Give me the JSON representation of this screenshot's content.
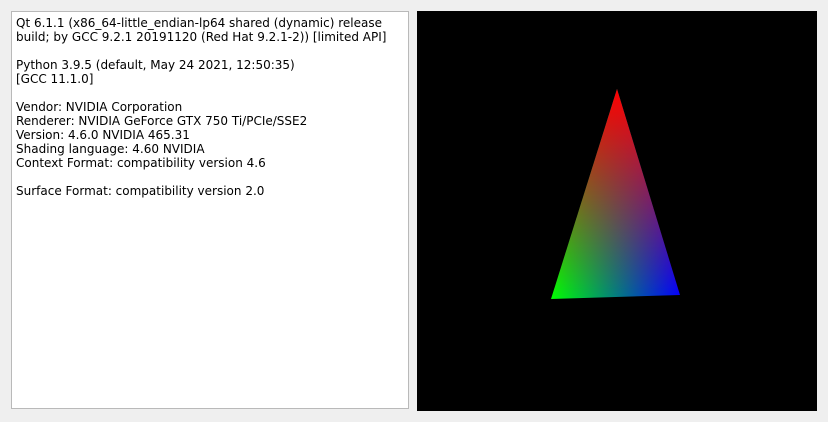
{
  "info_panel": {
    "text": "Qt 6.1.1 (x86_64-little_endian-lp64 shared (dynamic) release\nbuild; by GCC 9.2.1 20191120 (Red Hat 9.2.1-2)) [limited API]\n\nPython 3.9.5 (default, May 24 2021, 12:50:35)\n[GCC 11.1.0]\n\nVendor: NVIDIA Corporation\nRenderer: NVIDIA GeForce GTX 750 Ti/PCIe/SSE2\nVersion: 4.6.0 NVIDIA 465.31\nShading language: 4.60 NVIDIA\nContext Format: compatibility version 4.6\n\nSurface Format: compatibility version 2.0"
  },
  "gl_view": {
    "background": "#000000",
    "triangle": {
      "top_vertex_color": "#ff0000",
      "left_vertex_color": "#00ff00",
      "right_vertex_color": "#0000ff"
    }
  }
}
